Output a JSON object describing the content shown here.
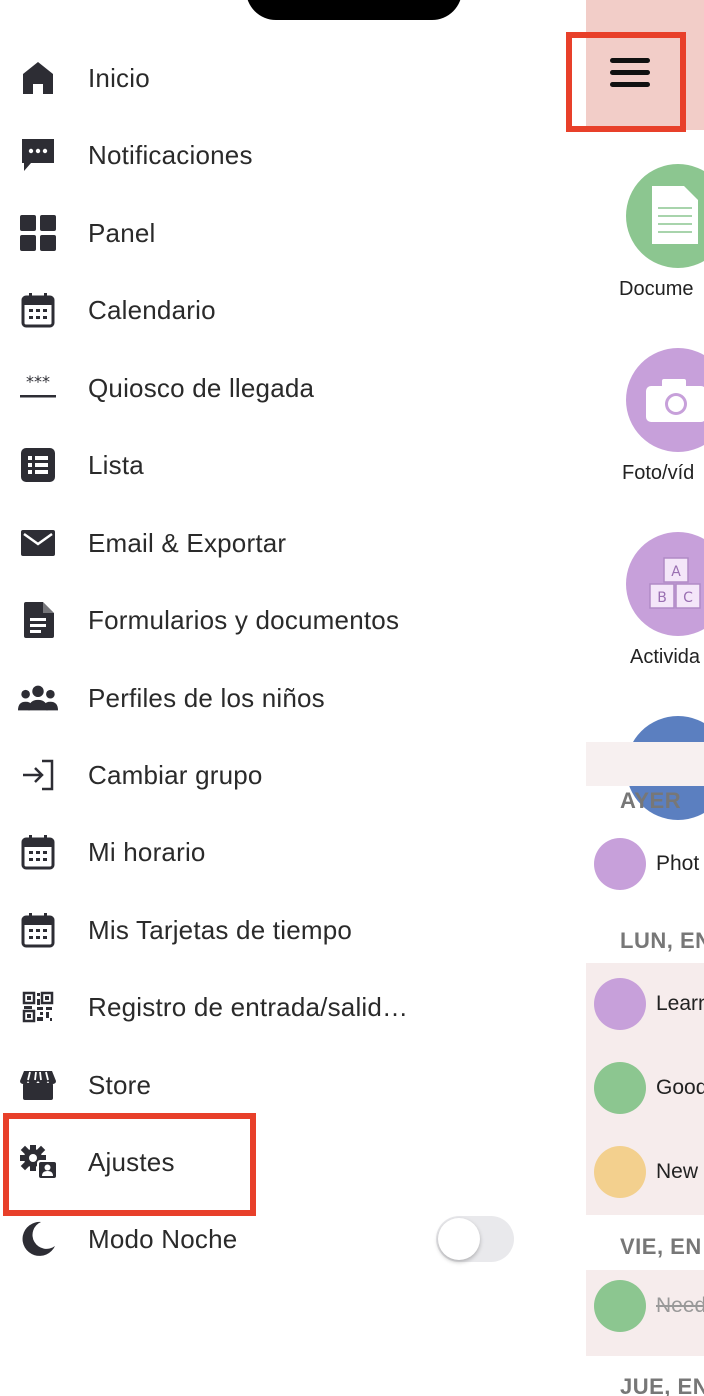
{
  "menu": {
    "items": [
      {
        "label": "Inicio",
        "icon": "home-icon"
      },
      {
        "label": "Notificaciones",
        "icon": "chat-bubble-icon"
      },
      {
        "label": "Panel",
        "icon": "dashboard-grid-icon"
      },
      {
        "label": "Calendario",
        "icon": "calendar-icon"
      },
      {
        "label": "Quiosco de llegada",
        "icon": "pin-code-icon"
      },
      {
        "label": "Lista",
        "icon": "list-icon"
      },
      {
        "label": "Email & Exportar",
        "icon": "envelope-icon"
      },
      {
        "label": "Formularios y documentos",
        "icon": "document-icon"
      },
      {
        "label": "Perfiles de los niños",
        "icon": "group-icon"
      },
      {
        "label": "Cambiar grupo",
        "icon": "sign-in-icon"
      },
      {
        "label": "Mi horario",
        "icon": "calendar-icon"
      },
      {
        "label": "Mis Tarjetas de tiempo",
        "icon": "calendar-icon"
      },
      {
        "label": "Registro de entrada/salid…",
        "icon": "qr-code-icon"
      },
      {
        "label": "Store",
        "icon": "store-icon"
      },
      {
        "label": "Ajustes",
        "icon": "settings-user-icon"
      },
      {
        "label": "Modo Noche",
        "icon": "moon-icon"
      }
    ],
    "night_mode_on": false
  },
  "background": {
    "quick_actions": [
      {
        "label": "Docume",
        "color": "#8cc690"
      },
      {
        "label": "Foto/víd",
        "color": "#c7a0da"
      },
      {
        "label": "Activida",
        "color": "#c7a0da"
      }
    ],
    "sections": [
      {
        "heading": "AYER"
      },
      {
        "heading": "LUN, EN"
      },
      {
        "heading": "VIE, EN"
      },
      {
        "heading": "JUE, EN"
      }
    ],
    "feed": [
      {
        "text": "Phot",
        "color": "#c7a0da"
      },
      {
        "text": "Learn",
        "color": "#c7a0da"
      },
      {
        "text": "Good",
        "color": "#8cc690"
      },
      {
        "text": "New",
        "color": "#f3d08e"
      },
      {
        "text": "Need",
        "color": "#8cc690"
      }
    ]
  },
  "colors": {
    "highlight": "#e8402a",
    "topbar": "#f2cdc8",
    "icon": "#2d2d34"
  }
}
